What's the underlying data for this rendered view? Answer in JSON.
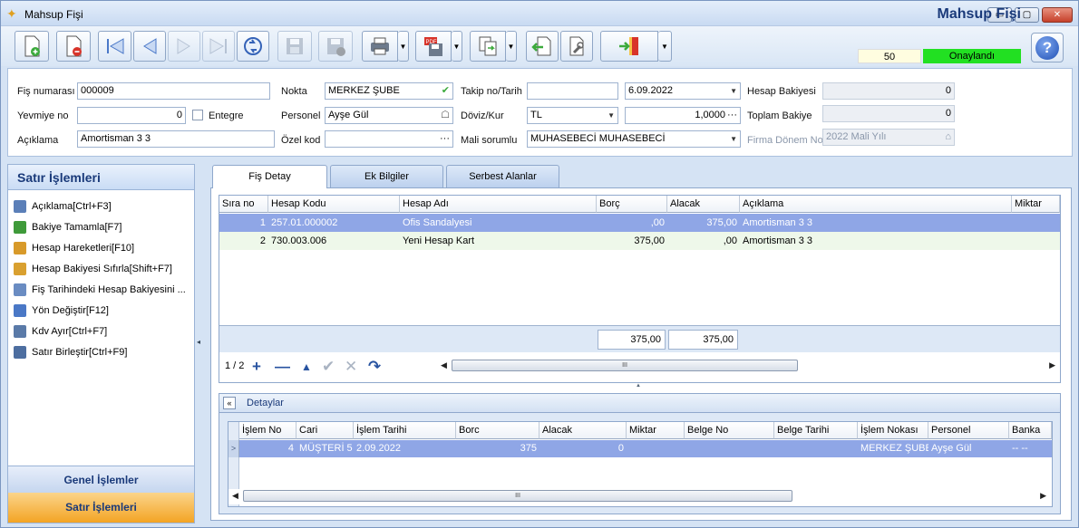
{
  "window": {
    "title": "Mahsup Fişi",
    "btn_min": "▭",
    "btn_max": "▢",
    "btn_close": "✕"
  },
  "header": {
    "title": "Mahsup Fişi",
    "count": "50",
    "status": "Onaylandı",
    "status_color": "#22e022",
    "help": "?"
  },
  "toolbar": {
    "buttons": [
      "new-document-icon",
      "delete-document-icon",
      "first-record-icon",
      "previous-record-icon",
      "next-record-icon",
      "last-record-icon",
      "refresh-icon",
      "save-disabled-icon",
      "cancel-disabled-icon",
      "print-icon",
      "pdf-export-icon",
      "copy-document-icon",
      "import-icon",
      "settings-tools-icon",
      "exit-door-icon"
    ]
  },
  "form": {
    "fis_numarasi_label": "Fiş numarası",
    "fis_numarasi": "000009",
    "yevmiye_label": "Yevmiye no",
    "yevmiye": "0",
    "entegre_label": "Entegre",
    "aciklama_label": "Açıklama",
    "aciklama": "Amortisman   3 3",
    "nokta_label": "Nokta",
    "nokta": "MERKEZ ŞUBE",
    "personel_label": "Personel",
    "personel": "Ayşe Gül",
    "ozel_kod_label": "Özel kod",
    "ozel_kod": "",
    "ozel_kod_btn": "···",
    "takip_label": "Takip no/Tarih",
    "takip_no": "",
    "tarih": "6.09.2022",
    "doviz_label": "Döviz/Kur",
    "doviz": "TL",
    "kur": "1,0000",
    "kur_btn": "···",
    "mali_label": "Mali sorumlu",
    "mali": "MUHASEBECİ MUHASEBECİ",
    "hesap_bakiyesi_label": "Hesap Bakiyesi",
    "hesap_bakiyesi": "0",
    "toplam_bakiye_label": "Toplam Bakiye",
    "toplam_bakiye": "0",
    "firma_donem_label": "Firma Dönem No",
    "firma_donem": "2022 Mali Yılı"
  },
  "left_panel": {
    "title": "Satır İşlemleri",
    "items": [
      {
        "label": "Açıklama[Ctrl+F3]",
        "color": "#5b7fb8"
      },
      {
        "label": "Bakiye Tamamla[F7]",
        "color": "#3f9a3a"
      },
      {
        "label": "Hesap Hareketleri[F10]",
        "color": "#d89a2a"
      },
      {
        "label": "Hesap Bakiyesi Sıfırla[Shift+F7]",
        "color": "#d9a030"
      },
      {
        "label": "Fiş Tarihindeki Hesap Bakiyesini ...",
        "color": "#6a8cc2"
      },
      {
        "label": "Yön Değiştir[F12]",
        "color": "#4a78c6"
      },
      {
        "label": "Kdv Ayır[Ctrl+F7]",
        "color": "#5a7aa8"
      },
      {
        "label": "Satır Birleştir[Ctrl+F9]",
        "color": "#4d6ea0"
      }
    ],
    "general": "Genel İşlemler",
    "row_ops": "Satır İşlemleri"
  },
  "tabs": [
    "Fiş Detay",
    "Ek Bilgiler",
    "Serbest Alanlar"
  ],
  "main_grid": {
    "columns": [
      "Sıra no",
      "Hesap Kodu",
      "Hesap Adı",
      "Borç",
      "Alacak",
      "Açıklama",
      "Miktar"
    ],
    "rows": [
      [
        "1",
        "257.01.000002",
        "Ofis Sandalyesi",
        ",00",
        "375,00",
        "Amortisman   3 3",
        ""
      ],
      [
        "2",
        "730.003.006",
        "Yeni Hesap Kart",
        "375,00",
        ",00",
        "Amortisman   3 3",
        ""
      ]
    ],
    "sum_borc": "375,00",
    "sum_alacak": "375,00",
    "pager": "1 / 2",
    "nav": [
      "+",
      "—",
      "▲",
      "✔",
      "✕",
      "↷"
    ],
    "scroll_thumb": "III"
  },
  "details": {
    "title": "Detaylar",
    "toggle": "«",
    "columns": [
      "İşlem No",
      "Cari",
      "İşlem Tarihi",
      "Borc",
      "Alacak",
      "Miktar",
      "Belge No",
      "Belge Tarihi",
      "İşlem Nokası",
      "Personel",
      "Banka"
    ],
    "rows": [
      [
        "4",
        "MÜŞTERİ 5",
        "2.09.2022",
        "375",
        "0",
        "",
        "",
        "",
        "MERKEZ ŞUBE",
        "Ayşe Gül",
        "-- --"
      ]
    ],
    "scroll_thumb": "III"
  }
}
